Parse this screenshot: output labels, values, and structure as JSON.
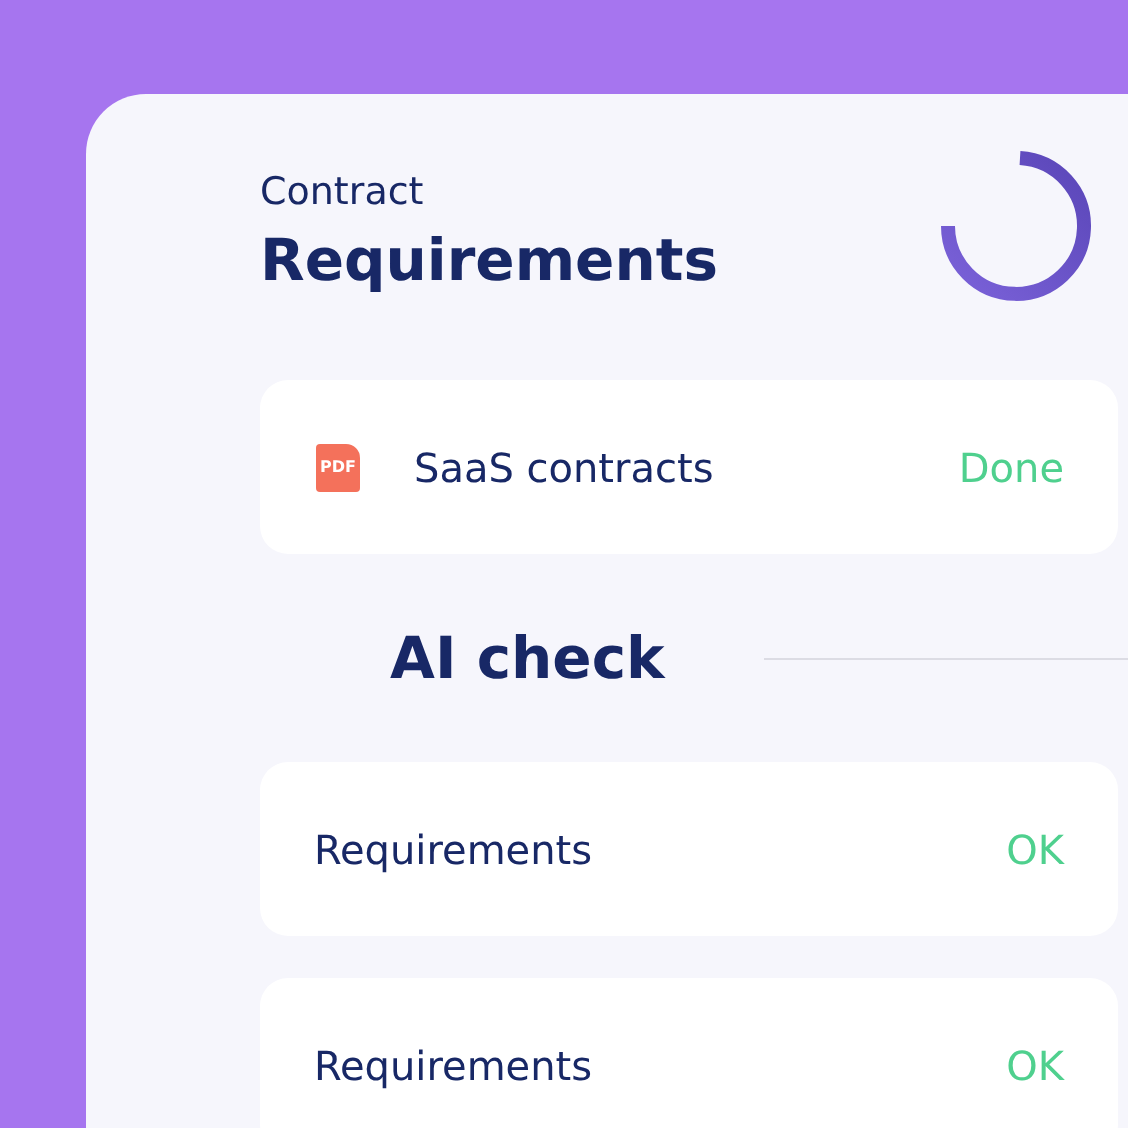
{
  "header": {
    "overline": "Contract",
    "title": "Requirements"
  },
  "file_item": {
    "icon_label": "PDF",
    "name": "SaaS contracts",
    "status": "Done"
  },
  "section": {
    "title": "AI check"
  },
  "checks": [
    {
      "label": "Requirements",
      "status": "OK"
    },
    {
      "label": "Requirements",
      "status": "OK"
    }
  ]
}
